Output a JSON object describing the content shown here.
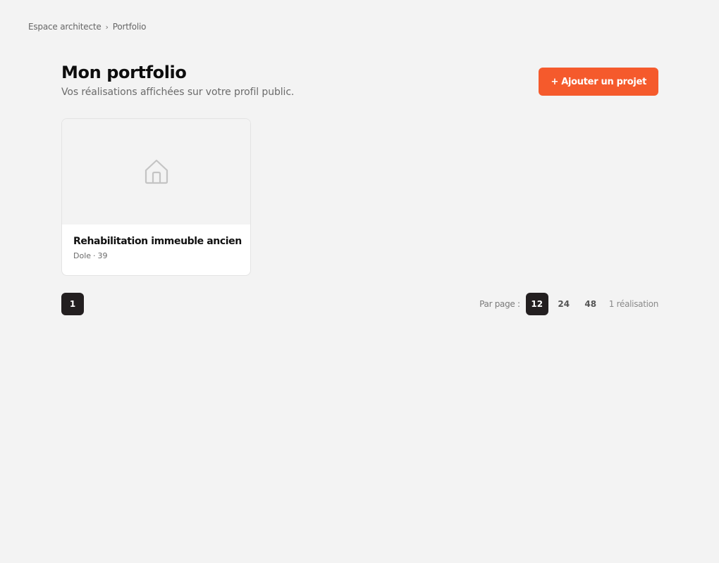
{
  "breadcrumb": {
    "items": [
      "Espace architecte",
      "Portfolio"
    ],
    "separator": "›"
  },
  "header": {
    "title": "Mon portfolio",
    "subtitle": "Vos réalisations affichées sur votre profil public.",
    "add_button_label": "+ Ajouter un projet"
  },
  "projects": [
    {
      "title": "Rehabilitation immeuble ancien",
      "city": "Dole",
      "meta_separator": "·",
      "department": "39",
      "thumbnail_icon": "house-icon"
    }
  ],
  "pagination": {
    "pages": [
      "1"
    ],
    "current": "1"
  },
  "per_page": {
    "label": "Par page :",
    "options": [
      "12",
      "24",
      "48"
    ],
    "selected": "12"
  },
  "result_count": "1 réalisation",
  "colors": {
    "accent": "#f55a2c",
    "dark": "#231f20",
    "background": "#f3f3f3"
  }
}
